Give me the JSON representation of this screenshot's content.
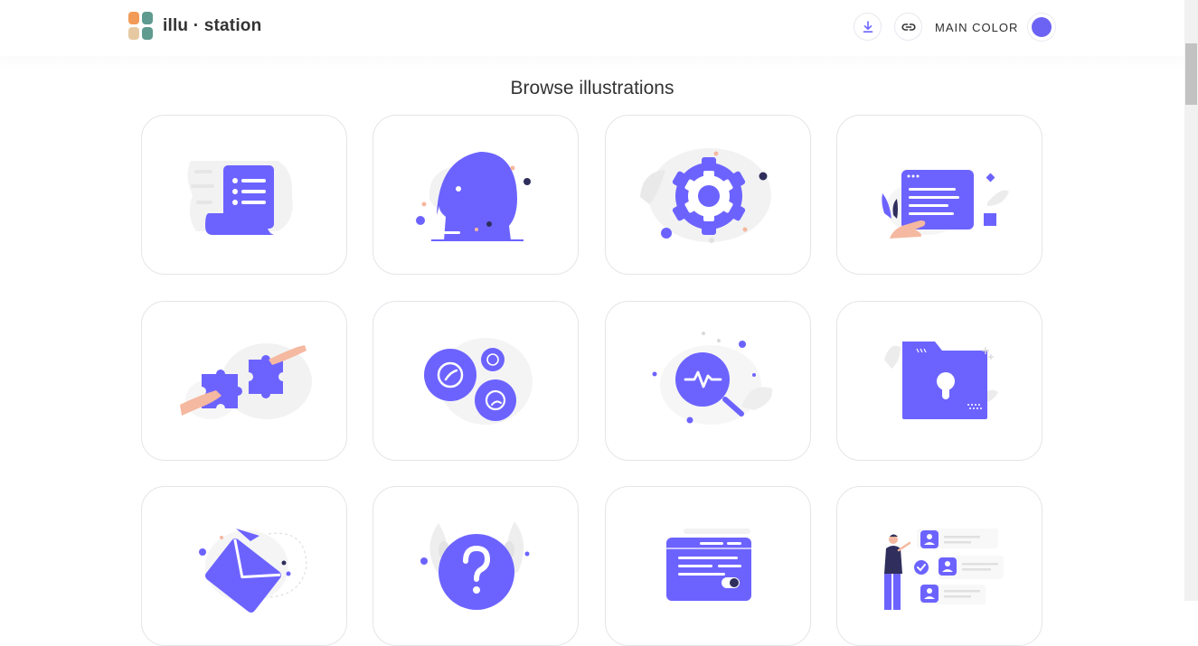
{
  "header": {
    "logo_text": "illu · station",
    "logo_colors": [
      "#f29a57",
      "#5f9a8f",
      "#e6c9a2",
      "#5f9a8f"
    ],
    "download_icon": "download-icon",
    "link_icon": "link-icon",
    "main_color_label": "MAIN COLOR",
    "main_color": "#6c63f4"
  },
  "page": {
    "title": "Browse illustrations"
  },
  "colors": {
    "primary": "#6c63ff",
    "dark": "#2f2e5c",
    "skin": "#f5b8a0",
    "light_gray": "#f2f2f2"
  },
  "illustrations": [
    "document-list",
    "head-profile",
    "settings-gear",
    "browser-window-hand",
    "puzzle-pieces-hands",
    "emoji-bubbles",
    "pulse-search",
    "secure-folder",
    "envelope-message",
    "question-mark",
    "web-page-toggle",
    "user-list-person"
  ]
}
